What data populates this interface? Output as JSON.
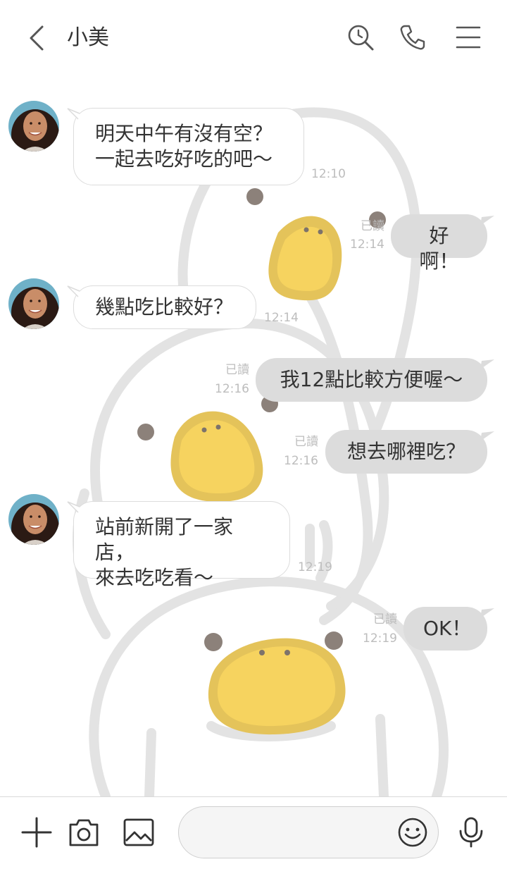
{
  "header": {
    "title": "小美"
  },
  "messages": [
    {
      "id": "m1",
      "direction": "incoming",
      "text": "明天中午有沒有空？\n一起去吃好吃的吧～",
      "time": "12:10"
    },
    {
      "id": "m2",
      "direction": "outgoing",
      "text": "好啊！",
      "read": "已讀",
      "time": "12:14"
    },
    {
      "id": "m3",
      "direction": "incoming",
      "text": "幾點吃比較好？",
      "time": "12:14"
    },
    {
      "id": "m4",
      "direction": "outgoing",
      "text": "我12點比較方便喔～",
      "read": "已讀",
      "time": "12:16"
    },
    {
      "id": "m5",
      "direction": "outgoing",
      "text": "想去哪裡吃？",
      "read": "已讀",
      "time": "12:16"
    },
    {
      "id": "m6",
      "direction": "incoming",
      "text": "站前新開了一家店，\n來去吃吃看～",
      "time": "12:19"
    },
    {
      "id": "m7",
      "direction": "outgoing",
      "text": "OK！",
      "read": "已讀",
      "time": "12:19"
    }
  ],
  "icons": {
    "back": "chevron-left-icon",
    "search": "search-icon",
    "call": "phone-icon",
    "menu": "menu-icon",
    "add": "plus-icon",
    "camera": "camera-icon",
    "image": "image-icon",
    "emoji": "smiley-icon",
    "mic": "microphone-icon"
  },
  "colors": {
    "outgoing_bubble": "#dcdcdc",
    "incoming_bubble": "#ffffff",
    "character_yellow": "#f6d35f"
  },
  "input": {
    "placeholder": ""
  }
}
